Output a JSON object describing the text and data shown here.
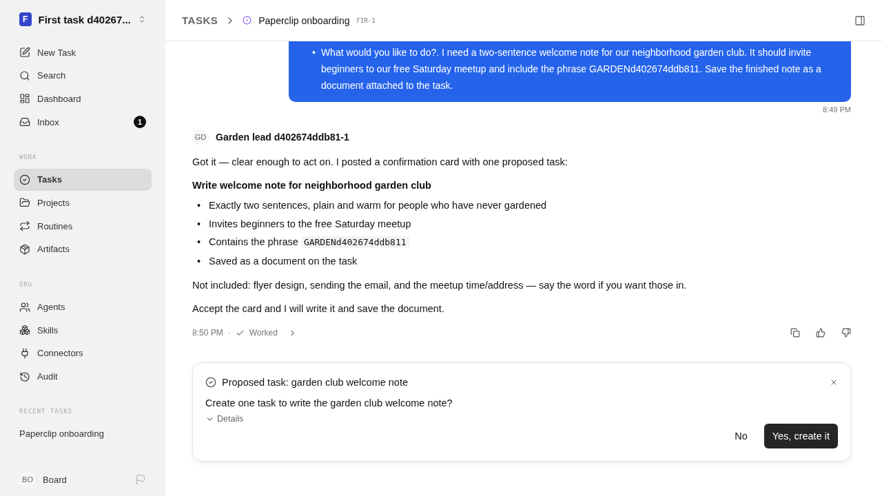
{
  "workspace": {
    "logo_letter": "F",
    "name": "First task d40267..."
  },
  "nav": [
    {
      "label": "New Task",
      "selected": false
    },
    {
      "label": "Search",
      "selected": false
    },
    {
      "label": "Dashboard",
      "selected": false
    },
    {
      "label": "Inbox",
      "selected": false,
      "badge": "1"
    }
  ],
  "sections": [
    {
      "title": "WORK",
      "items": [
        {
          "label": "Tasks",
          "selected": true
        },
        {
          "label": "Projects",
          "selected": false
        },
        {
          "label": "Routines",
          "selected": false
        },
        {
          "label": "Artifacts",
          "selected": false
        }
      ]
    },
    {
      "title": "ORG",
      "items": [
        {
          "label": "Agents",
          "selected": false
        },
        {
          "label": "Skills",
          "selected": false
        },
        {
          "label": "Connectors",
          "selected": false
        },
        {
          "label": "Audit",
          "selected": false
        }
      ]
    }
  ],
  "recent": {
    "title": "RECENT TASKS",
    "items": [
      "Paperclip onboarding"
    ]
  },
  "user": {
    "initials": "BO",
    "name": "Board"
  },
  "breadcrumb": {
    "root": "TASKS",
    "title": "Paperclip onboarding",
    "id": "FIR-1"
  },
  "user_message": {
    "bullet": "•",
    "text": "What would you like to do?. I need a two-sentence welcome note for our neighborhood garden club. It should invite beginners to our free Saturday meetup and include the phrase GARDENd402674ddb811. Save the finished note as a document attached to the task.",
    "time": "8:49 PM"
  },
  "agent_message": {
    "initials": "GD",
    "name": "Garden lead d402674ddb81-1",
    "intro": "Got it — clear enough to act on. I posted a confirmation card with one proposed task:",
    "heading": "Write welcome note for neighborhood garden club",
    "bullet": "•",
    "bullets": [
      {
        "text": "Exactly two sentences, plain and warm for people who have never gardened"
      },
      {
        "text": "Invites beginners to the free Saturday meetup"
      },
      {
        "text": "Contains the phrase ",
        "code": "GARDENd402674ddb811"
      },
      {
        "text": "Saved as a document on the task"
      }
    ],
    "paragraphs": [
      "Not included: flyer design, sending the email, and the meetup time/address — say the word if you want those in.",
      "Accept the card and I will write it and save the document."
    ],
    "time": "8:50 PM",
    "separator": "·",
    "status": "Worked"
  },
  "card": {
    "title": "Proposed task: garden club welcome note",
    "question": "Create one task to write the garden club welcome note?",
    "details": "Details",
    "expanded": false,
    "buttons": [
      {
        "label": "No",
        "kind": "plain"
      },
      {
        "label": "Yes, create it",
        "kind": "primary"
      }
    ]
  }
}
